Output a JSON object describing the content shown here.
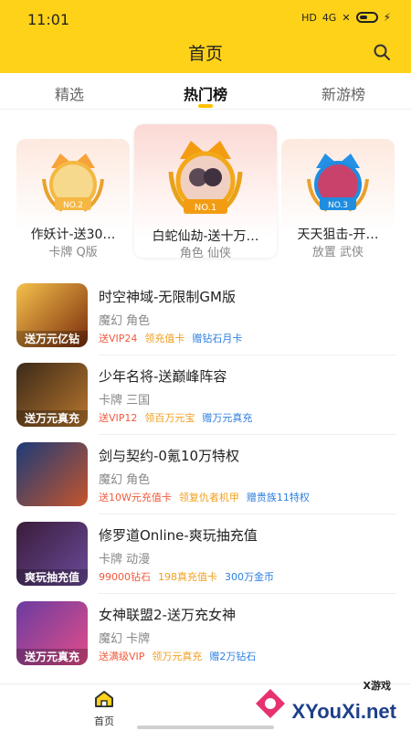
{
  "status_bar": {
    "time": "11:01",
    "network": "HD",
    "signal": "4G",
    "battery_icon": "battery-icon"
  },
  "header": {
    "title": "首页",
    "search_icon": "search-icon"
  },
  "tabs": [
    {
      "label": "精选",
      "active": false
    },
    {
      "label": "热门榜",
      "active": true
    },
    {
      "label": "新游榜",
      "active": false
    }
  ],
  "podium": [
    {
      "rank_label": "NO.2",
      "name": "作妖计-送30…",
      "tags": "卡牌  Q版",
      "badge_color": "#f5b842"
    },
    {
      "rank_label": "NO.1",
      "name": "白蛇仙劫-送十万…",
      "tags": "角色  仙侠",
      "badge_color": "#f39c12"
    },
    {
      "rank_label": "NO.3",
      "name": "天天狙击-开…",
      "tags": "放置  武侠",
      "badge_color": "#1f8de0"
    }
  ],
  "games": [
    {
      "name": "时空神域-无限制GM版",
      "tags": "魔幻  角色",
      "icon_caption": "送万元亿钻",
      "perks": [
        "送VIP24",
        "领充值卡",
        "赠钻石月卡"
      ],
      "icon_colors": [
        "#f6c14b",
        "#7a2b0c"
      ]
    },
    {
      "name": "少年名将-送巅峰阵容",
      "tags": "卡牌  三国",
      "icon_caption": "送万元真充",
      "perks": [
        "送VIP12",
        "领百万元宝",
        "赠万元真充"
      ],
      "icon_colors": [
        "#3b2a1a",
        "#b9762c"
      ]
    },
    {
      "name": "剑与契约-0氪10万特权",
      "tags": "魔幻  角色",
      "icon_caption": "",
      "perks": [
        "送10W元充值卡",
        "领复仇者机甲",
        "赠贵族11特权"
      ],
      "icon_colors": [
        "#1c3b78",
        "#c5552c"
      ]
    },
    {
      "name": "修罗道Online-爽玩抽充值",
      "tags": "卡牌  动漫",
      "icon_caption": "爽玩抽充值",
      "perks": [
        "99000钻石",
        "198真充值卡",
        "300万金币"
      ],
      "icon_colors": [
        "#3a1c3a",
        "#6b4a9a"
      ]
    },
    {
      "name": "女神联盟2-送万充女神",
      "tags": "魔幻  卡牌",
      "icon_caption": "送万元真充",
      "perks": [
        "送满级VIP",
        "领万元真充",
        "赠2万钻石"
      ],
      "icon_colors": [
        "#6a3ca0",
        "#e44d8a"
      ]
    }
  ],
  "bottom_nav": {
    "home_label": "首页",
    "home_icon": "home-icon"
  },
  "watermark": {
    "brand": "XYouXi.net",
    "small": "X游戏"
  }
}
